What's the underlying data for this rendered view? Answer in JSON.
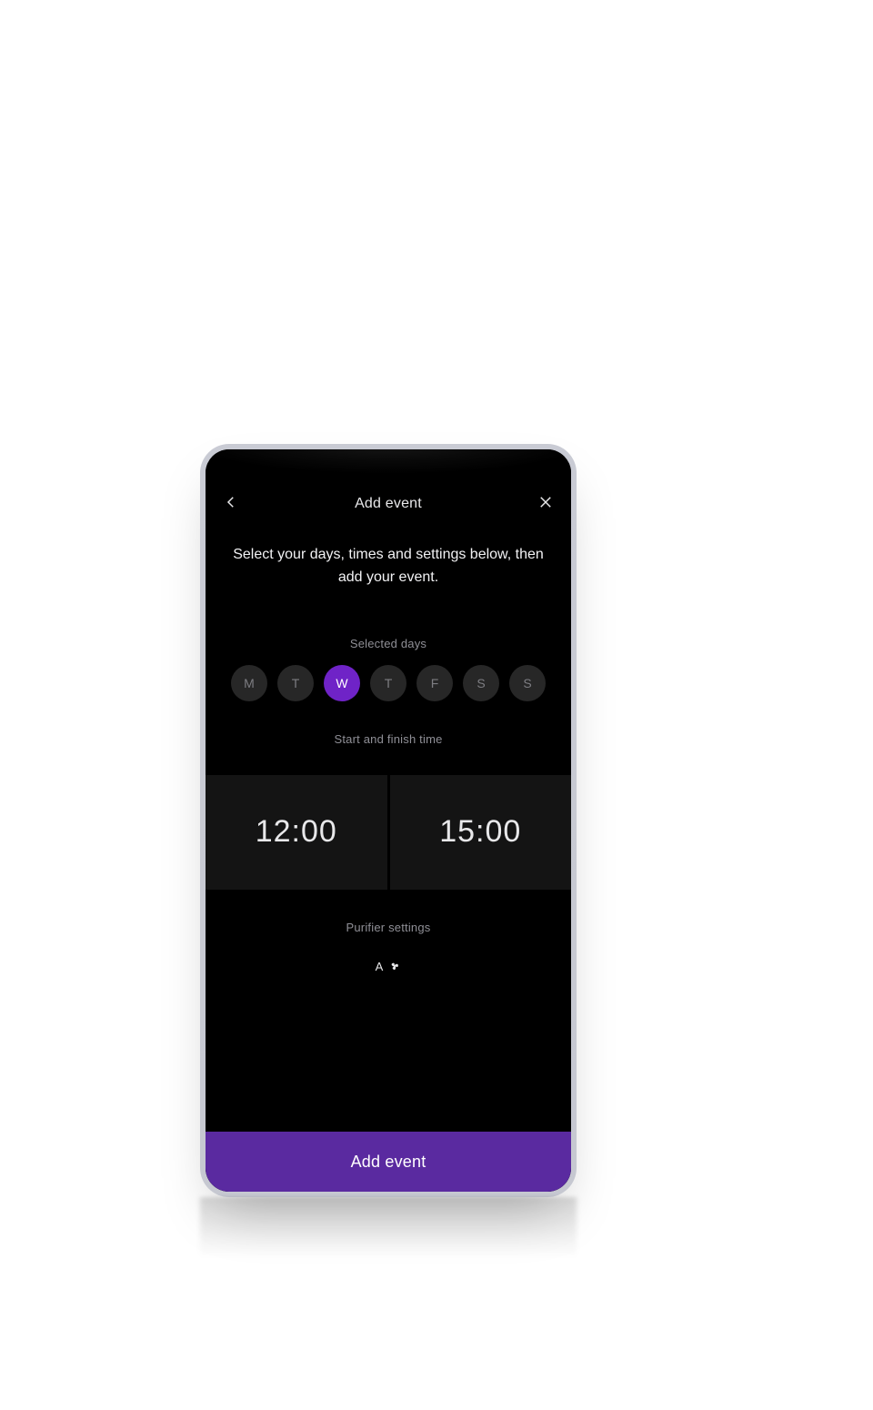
{
  "header": {
    "title": "Add event"
  },
  "instructions": "Select your days, times and settings below, then add your event.",
  "sections": {
    "selected_days_label": "Selected days",
    "time_label": "Start and finish time",
    "purifier_label": "Purifier settings"
  },
  "days": [
    {
      "label": "M",
      "selected": false
    },
    {
      "label": "T",
      "selected": false
    },
    {
      "label": "W",
      "selected": true
    },
    {
      "label": "T",
      "selected": false
    },
    {
      "label": "F",
      "selected": false
    },
    {
      "label": "S",
      "selected": false
    },
    {
      "label": "S",
      "selected": false
    }
  ],
  "times": {
    "start": "12:00",
    "finish": "15:00"
  },
  "purifier": {
    "mode": "A"
  },
  "cta": {
    "label": "Add event"
  },
  "colors": {
    "accent": "#6f23c7",
    "cta_bg": "#5a2aa0",
    "bg": "#000000",
    "panel": "#141414",
    "pill": "#272727",
    "muted_text": "#8f8f96",
    "text": "#e8e8ea"
  }
}
